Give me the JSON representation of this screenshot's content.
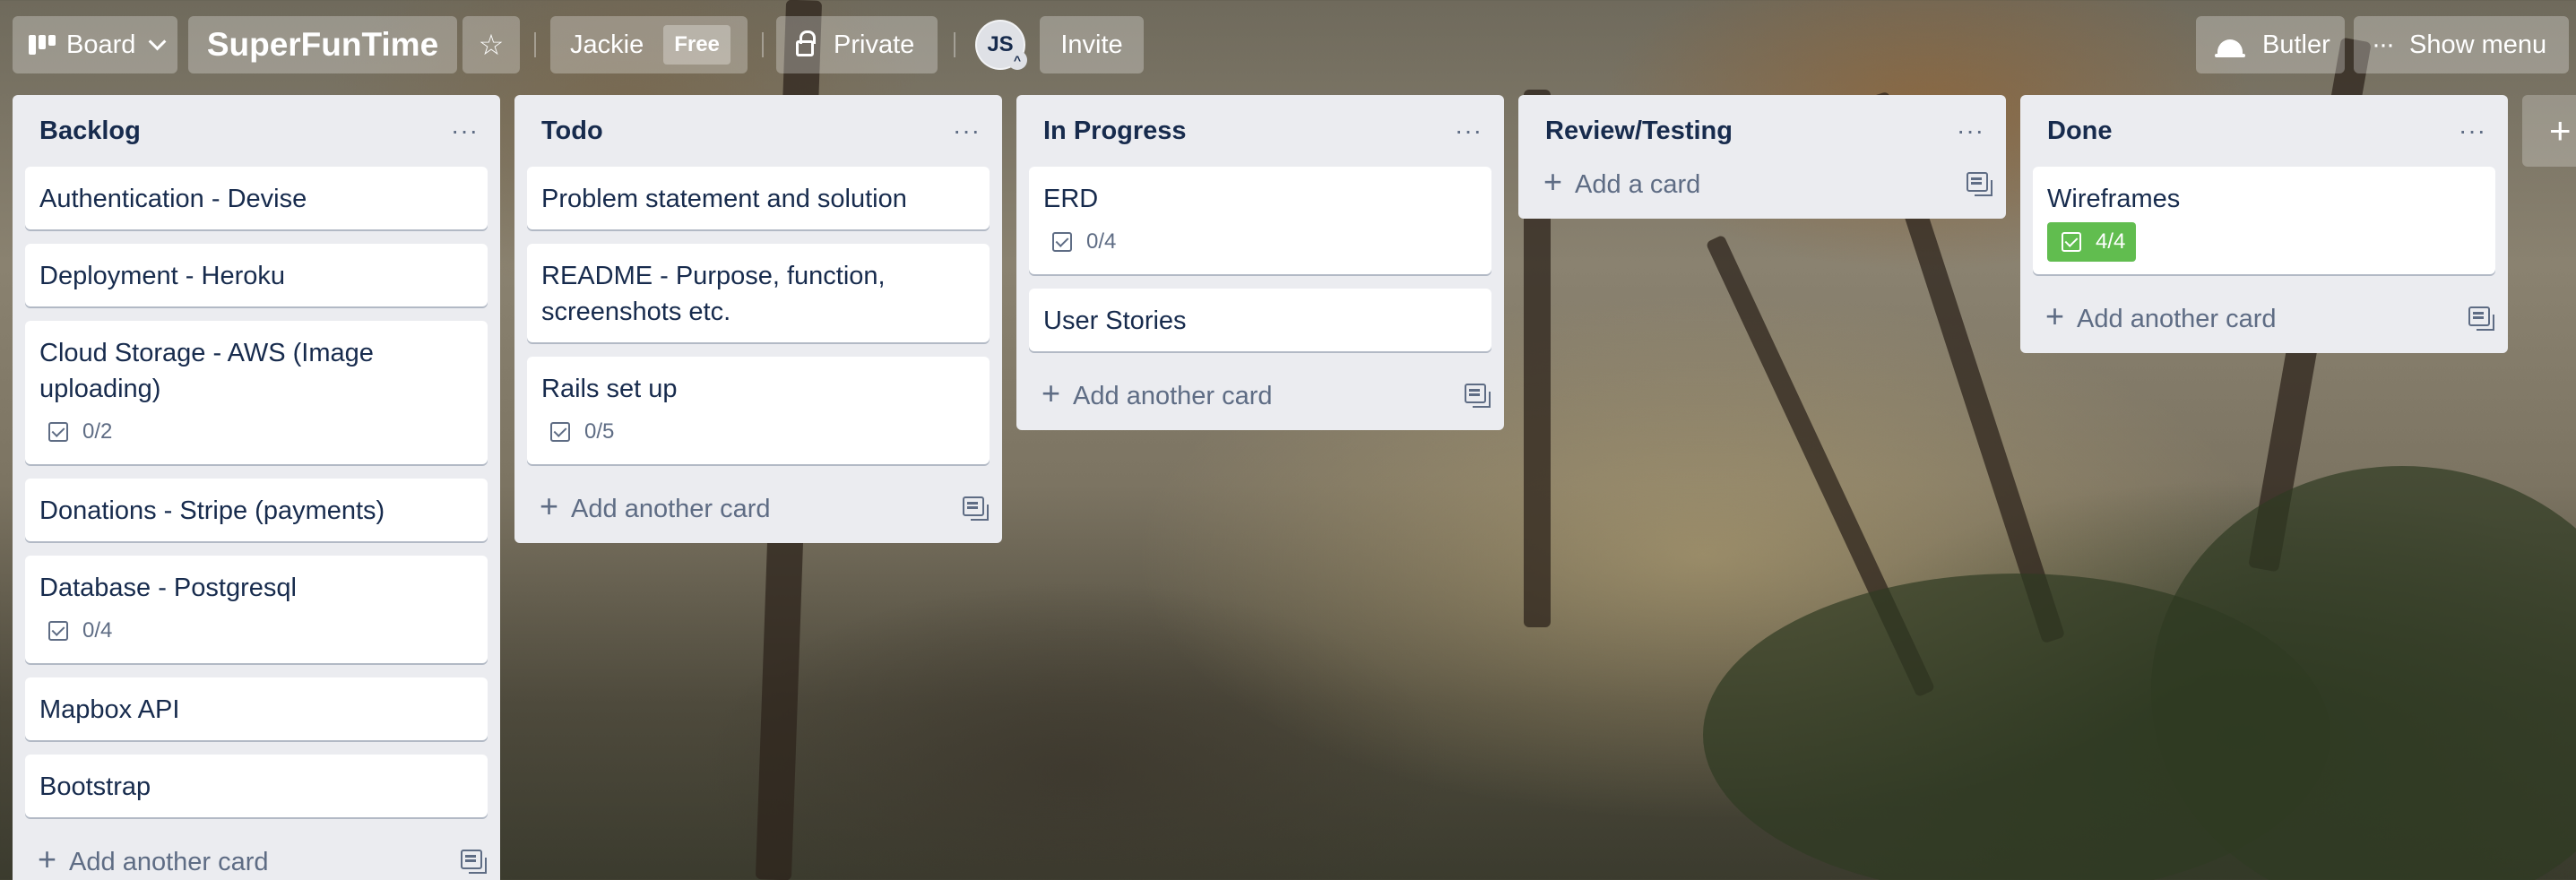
{
  "header": {
    "board_switcher": "Board",
    "board_title": "SuperFunTime",
    "team_name": "Jackie",
    "team_plan": "Free",
    "visibility": "Private",
    "member_initials": "JS",
    "invite": "Invite",
    "butler": "Butler",
    "show_menu": "Show menu",
    "star_icon": "star-icon"
  },
  "lists": [
    {
      "title": "Backlog",
      "cards": [
        {
          "title": "Authentication - Devise"
        },
        {
          "title": "Deployment - Heroku"
        },
        {
          "title": "Cloud Storage - AWS (Image uploading)",
          "checklist": "0/2"
        },
        {
          "title": "Donations - Stripe (payments)"
        },
        {
          "title": "Database - Postgresql",
          "checklist": "0/4"
        },
        {
          "title": "Mapbox API"
        },
        {
          "title": "Bootstrap"
        }
      ],
      "add_label": "Add another card"
    },
    {
      "title": "Todo",
      "cards": [
        {
          "title": "Problem statement and solution"
        },
        {
          "title": "README - Purpose, function, screenshots etc."
        },
        {
          "title": "Rails set up",
          "checklist": "0/5"
        }
      ],
      "add_label": "Add another card"
    },
    {
      "title": "In Progress",
      "cards": [
        {
          "title": "ERD",
          "checklist": "0/4"
        },
        {
          "title": "User Stories"
        }
      ],
      "add_label": "Add another card"
    },
    {
      "title": "Review/Testing",
      "cards": [],
      "add_label": "Add a card"
    },
    {
      "title": "Done",
      "cards": [
        {
          "title": "Wireframes",
          "checklist": "4/4",
          "checklist_complete": true
        }
      ],
      "add_label": "Add another card"
    }
  ],
  "colors": {
    "list_bg": "#ebecf0",
    "checklist_complete": "#61bd4f",
    "text": "#172b4d"
  }
}
